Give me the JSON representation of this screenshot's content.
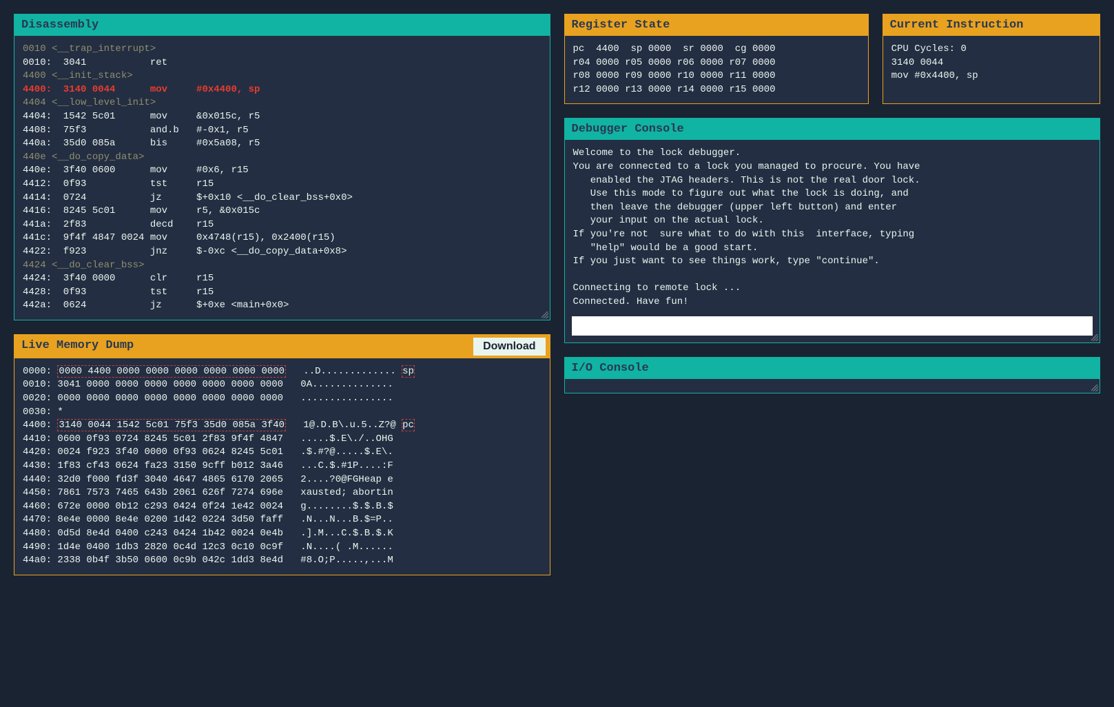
{
  "disassembly": {
    "title": "Disassembly",
    "lines": [
      {
        "cls": "label-line",
        "t": "0010 <__trap_interrupt>"
      },
      {
        "cls": "",
        "t": "0010:  3041           ret"
      },
      {
        "cls": "label-line",
        "t": "4400 <__init_stack>"
      },
      {
        "cls": "current-line",
        "t": "4400:  3140 0044      mov     #0x4400, sp"
      },
      {
        "cls": "label-line",
        "t": "4404 <__low_level_init>"
      },
      {
        "cls": "",
        "t": "4404:  1542 5c01      mov     &0x015c, r5"
      },
      {
        "cls": "",
        "t": "4408:  75f3           and.b   #-0x1, r5"
      },
      {
        "cls": "",
        "t": "440a:  35d0 085a      bis     #0x5a08, r5"
      },
      {
        "cls": "label-line",
        "t": "440e <__do_copy_data>"
      },
      {
        "cls": "",
        "t": "440e:  3f40 0600      mov     #0x6, r15"
      },
      {
        "cls": "",
        "t": "4412:  0f93           tst     r15"
      },
      {
        "cls": "",
        "t": "4414:  0724           jz      $+0x10 <__do_clear_bss+0x0>"
      },
      {
        "cls": "",
        "t": "4416:  8245 5c01      mov     r5, &0x015c"
      },
      {
        "cls": "",
        "t": "441a:  2f83           decd    r15"
      },
      {
        "cls": "",
        "t": "441c:  9f4f 4847 0024 mov     0x4748(r15), 0x2400(r15)"
      },
      {
        "cls": "",
        "t": "4422:  f923           jnz     $-0xc <__do_copy_data+0x8>"
      },
      {
        "cls": "label-line",
        "t": "4424 <__do_clear_bss>"
      },
      {
        "cls": "",
        "t": "4424:  3f40 0000      clr     r15"
      },
      {
        "cls": "",
        "t": "4428:  0f93           tst     r15"
      },
      {
        "cls": "",
        "t": "442a:  0624           jz      $+0xe <main+0x0>"
      }
    ]
  },
  "memory": {
    "title": "Live Memory Dump",
    "download_label": "Download",
    "lines": [
      {
        "addr": "0000:",
        "hex": "0000 4400 0000 0000 0000 0000 0000 0000",
        "ascii": "..D.............",
        "mark_hex": true,
        "mark_ptr": "sp"
      },
      {
        "addr": "0010:",
        "hex": "3041 0000 0000 0000 0000 0000 0000 0000",
        "ascii": "0A.............."
      },
      {
        "addr": "0020:",
        "hex": "0000 0000 0000 0000 0000 0000 0000 0000",
        "ascii": "................"
      },
      {
        "addr": "0030:",
        "hex": "*",
        "ascii": ""
      },
      {
        "addr": "4400:",
        "hex": "3140 0044 1542 5c01 75f3 35d0 085a 3f40",
        "ascii": "1@.D.B\\.u.5..Z?@",
        "mark_hex": true,
        "mark_ptr": "pc"
      },
      {
        "addr": "4410:",
        "hex": "0600 0f93 0724 8245 5c01 2f83 9f4f 4847",
        "ascii": ".....$.E\\./..OHG"
      },
      {
        "addr": "4420:",
        "hex": "0024 f923 3f40 0000 0f93 0624 8245 5c01",
        "ascii": ".$.#?@.....$.E\\."
      },
      {
        "addr": "4430:",
        "hex": "1f83 cf43 0624 fa23 3150 9cff b012 3a46",
        "ascii": "...C.$.#1P....:F"
      },
      {
        "addr": "4440:",
        "hex": "32d0 f000 fd3f 3040 4647 4865 6170 2065",
        "ascii": "2....?0@FGHeap e"
      },
      {
        "addr": "4450:",
        "hex": "7861 7573 7465 643b 2061 626f 7274 696e",
        "ascii": "xausted; abortin"
      },
      {
        "addr": "4460:",
        "hex": "672e 0000 0b12 c293 0424 0f24 1e42 0024",
        "ascii": "g........$.$.B.$"
      },
      {
        "addr": "4470:",
        "hex": "8e4e 0000 8e4e 0200 1d42 0224 3d50 faff",
        "ascii": ".N...N...B.$=P.."
      },
      {
        "addr": "4480:",
        "hex": "0d5d 8e4d 0400 c243 0424 1b42 0024 0e4b",
        "ascii": ".].M...C.$.B.$.K"
      },
      {
        "addr": "4490:",
        "hex": "1d4e 0400 1db3 2820 0c4d 12c3 0c10 0c9f",
        "ascii": ".N....( .M......"
      },
      {
        "addr": "44a0:",
        "hex": "2338 0b4f 3b50 0600 0c9b 042c 1dd3 8e4d",
        "ascii": "#8.O;P.....,...M"
      }
    ]
  },
  "registers": {
    "title": "Register State",
    "lines": [
      "pc  4400  sp 0000  sr 0000  cg 0000",
      "r04 0000 r05 0000 r06 0000 r07 0000",
      "r08 0000 r09 0000 r10 0000 r11 0000",
      "r12 0000 r13 0000 r14 0000 r15 0000"
    ]
  },
  "current_insn": {
    "title": "Current Instruction",
    "lines": [
      "CPU Cycles: 0",
      "3140 0044",
      "mov #0x4400, sp"
    ]
  },
  "debugger": {
    "title": "Debugger Console",
    "text": "Welcome to the lock debugger.\nYou are connected to a lock you managed to procure. You have\n   enabled the JTAG headers. This is not the real door lock.\n   Use this mode to figure out what the lock is doing, and\n   then leave the debugger (upper left button) and enter\n   your input on the actual lock.\nIf you're not  sure what to do with this  interface, typing\n   \"help\" would be a good start.\nIf you just want to see things work, type \"continue\".\n\nConnecting to remote lock ...\nConnected. Have fun!",
    "input_value": ""
  },
  "io": {
    "title": "I/O Console",
    "text": ""
  }
}
